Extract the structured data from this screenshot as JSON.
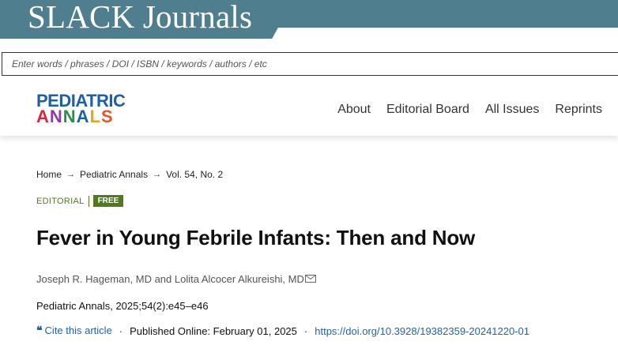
{
  "banner": {
    "brand": "SLACK Journals"
  },
  "search": {
    "placeholder": "Enter words / phrases / DOI / ISBN / keywords / authors / etc"
  },
  "logo": {
    "line1": "PEDIATRIC",
    "line2_parts": [
      "A",
      "N",
      "N",
      "A",
      "L",
      "S"
    ]
  },
  "nav": {
    "items": [
      "About",
      "Editorial Board",
      "All Issues",
      "Reprints"
    ]
  },
  "breadcrumb": {
    "items": [
      "Home",
      "Pediatric Annals",
      "Vol. 54, No. 2"
    ],
    "separator": "→"
  },
  "article": {
    "section": "EDITORIAL",
    "access_badge": "FREE",
    "title": "Fever in Young Febrile Infants: Then and Now",
    "authors": "Joseph R. Hageman, MD and Lolita Alcocer Alkureishi, MD",
    "citation": "Pediatric Annals, 2025;54(2):e45–e46",
    "cite_label": "Cite this article",
    "published": "Published Online: February 01, 2025",
    "doi": "https://doi.org/10.3928/19382359-20241220-01"
  },
  "colors": {
    "banner": "#4f7f8f",
    "editorial_green": "#4f7a1d",
    "link_blue": "#1f62b3"
  },
  "icons": {
    "author_mail": "envelope-icon",
    "cite": "quote-icon",
    "crumb": "arrow-right-icon"
  }
}
